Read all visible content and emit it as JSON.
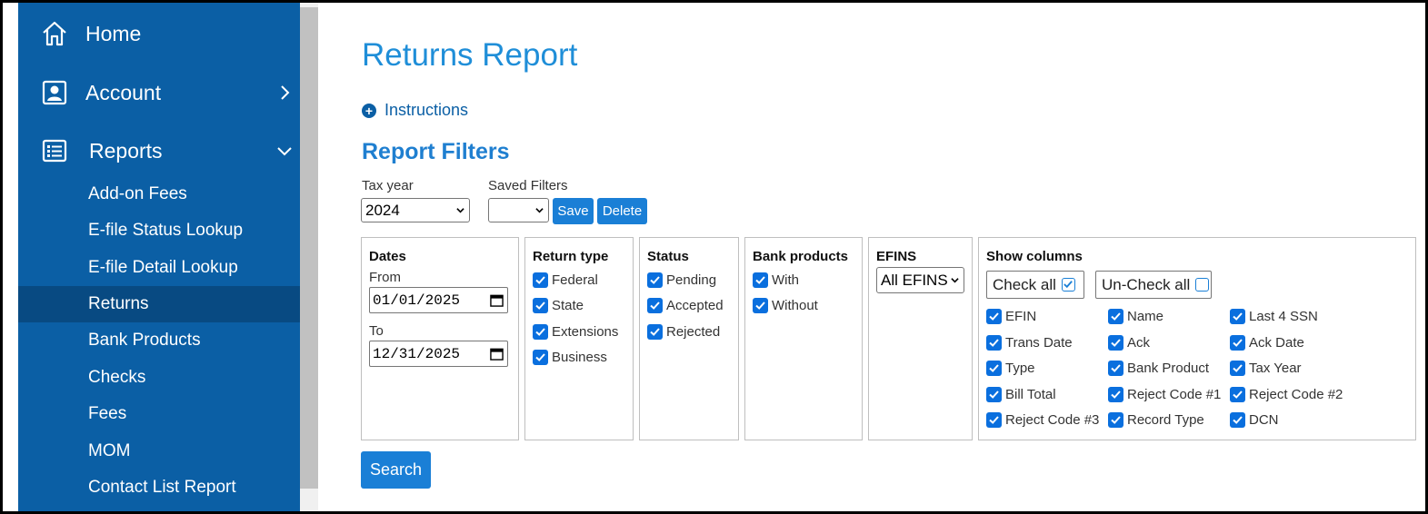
{
  "sidebar": {
    "home": "Home",
    "account": "Account",
    "reports": "Reports",
    "items": [
      "Add-on Fees",
      "E-file Status Lookup",
      "E-file Detail Lookup",
      "Returns",
      "Bank Products",
      "Checks",
      "Fees",
      "MOM",
      "Contact List Report"
    ],
    "active": "Returns"
  },
  "page": {
    "title": "Returns Report",
    "instructions": "Instructions",
    "filters_heading": "Report Filters"
  },
  "filters": {
    "tax_year_label": "Tax year",
    "tax_year_value": "2024",
    "saved_filters_label": "Saved Filters",
    "saved_filters_value": "",
    "save_label": "Save",
    "delete_label": "Delete"
  },
  "dates": {
    "heading": "Dates",
    "from_label": "From",
    "from_value": "01/01/2025",
    "to_label": "To",
    "to_value": "12/31/2025"
  },
  "return_type": {
    "heading": "Return type",
    "options": [
      "Federal",
      "State",
      "Extensions",
      "Business"
    ]
  },
  "status": {
    "heading": "Status",
    "options": [
      "Pending",
      "Accepted",
      "Rejected"
    ]
  },
  "bank_products": {
    "heading": "Bank products",
    "options": [
      "With",
      "Without"
    ]
  },
  "efins": {
    "heading": "EFINS",
    "value": "All EFINS"
  },
  "show_columns": {
    "heading": "Show columns",
    "check_all": "Check all",
    "uncheck_all": "Un-Check all",
    "columns": [
      [
        "EFIN",
        "Trans Date",
        "Type",
        "Bill Total",
        "Reject Code #3"
      ],
      [
        "Name",
        "Ack",
        "Bank Product",
        "Reject Code #1",
        "Record Type"
      ],
      [
        "Last 4 SSN",
        "Ack Date",
        "Tax Year",
        "Reject Code #2",
        "DCN"
      ]
    ]
  },
  "search_label": "Search",
  "colors": {
    "sidebar": "#0b5fa5",
    "sidebar_active": "#084a82",
    "accent": "#1a7fd6",
    "title": "#1f8ed8"
  }
}
